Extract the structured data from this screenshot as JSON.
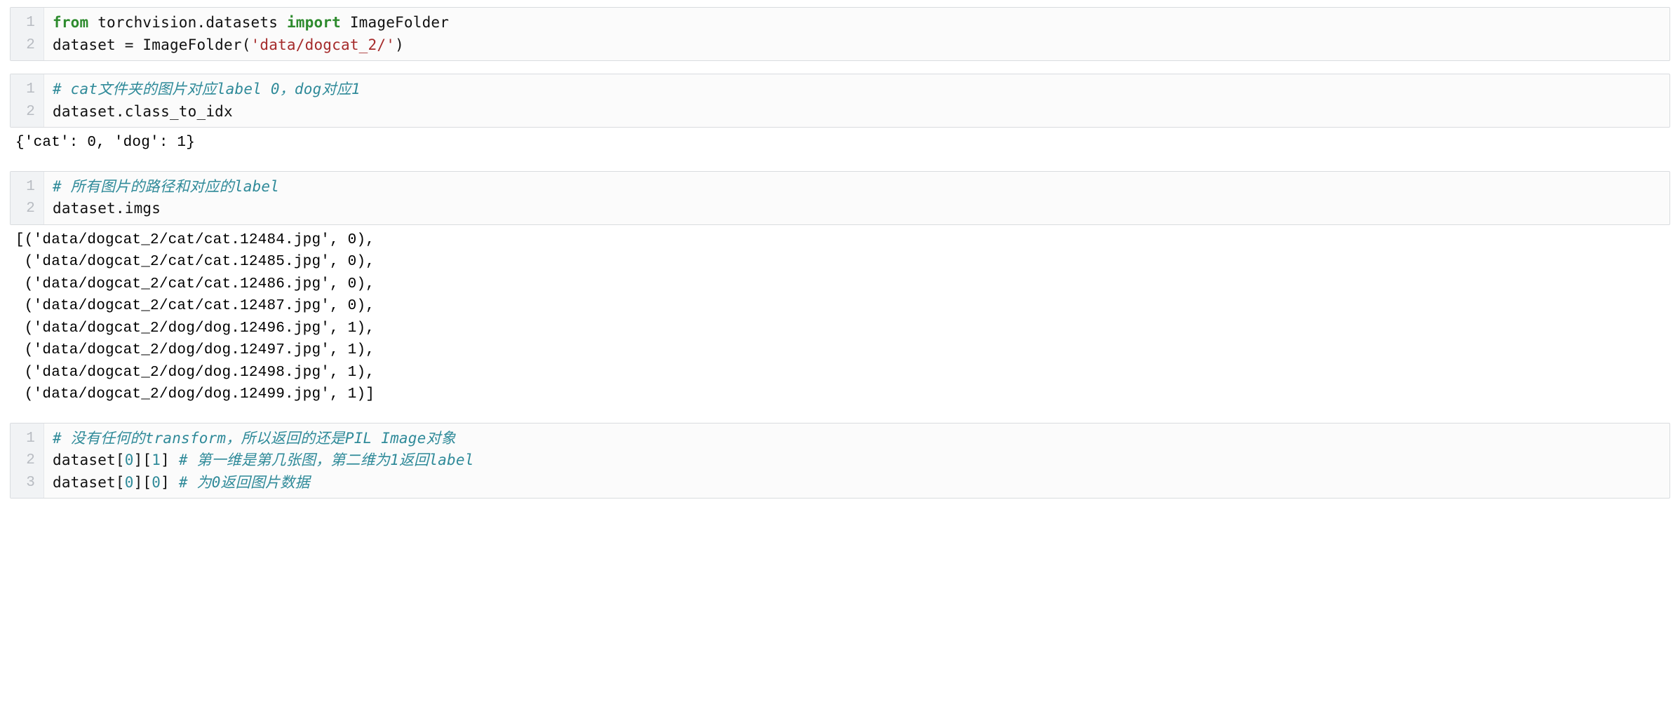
{
  "cells": [
    {
      "gutter": [
        "1",
        "2"
      ],
      "lines": [
        {
          "segments": [
            {
              "t": "from",
              "c": "s-keyword"
            },
            {
              "t": " torchvision.datasets ",
              "c": "s-name"
            },
            {
              "t": "import",
              "c": "s-keyword"
            },
            {
              "t": " ImageFolder",
              "c": "s-name"
            }
          ]
        },
        {
          "segments": [
            {
              "t": "dataset = ImageFolder(",
              "c": "s-name"
            },
            {
              "t": "'data/dogcat_2/'",
              "c": "s-string"
            },
            {
              "t": ")",
              "c": "s-name"
            }
          ]
        }
      ],
      "output": null
    },
    {
      "gutter": [
        "1",
        "2"
      ],
      "lines": [
        {
          "segments": [
            {
              "t": "# cat文件夹的图片对应label 0，dog对应1",
              "c": "s-comment"
            }
          ]
        },
        {
          "segments": [
            {
              "t": "dataset.class_to_idx",
              "c": "s-name"
            }
          ]
        }
      ],
      "output": "{'cat': 0, 'dog': 1}"
    },
    {
      "gutter": [
        "1",
        "2"
      ],
      "lines": [
        {
          "segments": [
            {
              "t": "# 所有图片的路径和对应的label",
              "c": "s-comment"
            }
          ]
        },
        {
          "segments": [
            {
              "t": "dataset.imgs",
              "c": "s-name"
            }
          ]
        }
      ],
      "output": "[('data/dogcat_2/cat/cat.12484.jpg', 0),\n ('data/dogcat_2/cat/cat.12485.jpg', 0),\n ('data/dogcat_2/cat/cat.12486.jpg', 0),\n ('data/dogcat_2/cat/cat.12487.jpg', 0),\n ('data/dogcat_2/dog/dog.12496.jpg', 1),\n ('data/dogcat_2/dog/dog.12497.jpg', 1),\n ('data/dogcat_2/dog/dog.12498.jpg', 1),\n ('data/dogcat_2/dog/dog.12499.jpg', 1)]"
    },
    {
      "gutter": [
        "1",
        "2",
        "3"
      ],
      "lines": [
        {
          "segments": [
            {
              "t": "# 没有任何的transform，所以返回的还是PIL Image对象",
              "c": "s-comment"
            }
          ]
        },
        {
          "segments": [
            {
              "t": "dataset[",
              "c": "s-name"
            },
            {
              "t": "0",
              "c": "s-number"
            },
            {
              "t": "][",
              "c": "s-name"
            },
            {
              "t": "1",
              "c": "s-number"
            },
            {
              "t": "] ",
              "c": "s-name"
            },
            {
              "t": "# 第一维是第几张图，第二维为1返回label",
              "c": "s-comment"
            }
          ]
        },
        {
          "segments": [
            {
              "t": "dataset[",
              "c": "s-name"
            },
            {
              "t": "0",
              "c": "s-number"
            },
            {
              "t": "][",
              "c": "s-name"
            },
            {
              "t": "0",
              "c": "s-number"
            },
            {
              "t": "] ",
              "c": "s-name"
            },
            {
              "t": "# 为0返回图片数据",
              "c": "s-comment"
            }
          ]
        }
      ],
      "output": null
    }
  ]
}
